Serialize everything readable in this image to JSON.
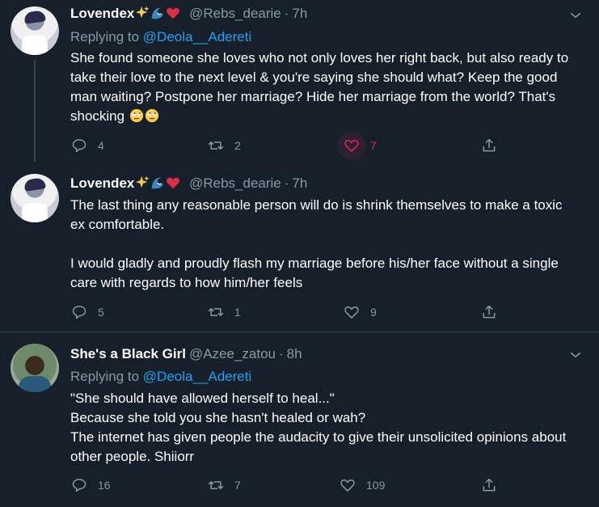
{
  "tweets": [
    {
      "name": "Lovendex",
      "name_emoji": [
        "sparkles-icon",
        "wave-icon",
        "heart-icon"
      ],
      "handle": "@Rebs_dearie",
      "dot": "·",
      "time": "7h",
      "replying_prefix": "Replying to",
      "replying_to": "@Deola__Adereti",
      "text": "She found someone she loves who not only loves her right back, but also ready to take their love to the next level & you're saying she should what? Keep the good man waiting? Postpone her marriage? Hide her marriage from the world? That's shocking",
      "text_emoji": [
        "face-with-rolling-eyes-icon",
        "face-with-rolling-eyes-icon"
      ],
      "replies": "4",
      "retweets": "2",
      "likes": "7",
      "liked": true
    },
    {
      "name": "Lovendex",
      "name_emoji": [
        "sparkles-icon",
        "wave-icon",
        "heart-icon"
      ],
      "handle": "@Rebs_dearie",
      "dot": "·",
      "time": "7h",
      "text_p1": "The last thing any reasonable person will do is shrink themselves to make a toxic ex comfortable.",
      "text_p2": "I would gladly and proudly flash my marriage before his/her face without a single care with regards to how him/her feels",
      "replies": "5",
      "retweets": "1",
      "likes": "9",
      "liked": false
    },
    {
      "name": "She's a Black Girl",
      "handle": "@Azee_zatou",
      "dot": "·",
      "time": "8h",
      "replying_prefix": "Replying to",
      "replying_to": "@Deola__Adereti",
      "text_lines": [
        "\"She should have allowed herself to heal...\"",
        "Because she told you she hasn't healed or wah?",
        "The internet has given people the audacity to give their unsolicited opinions about other people. Shiiorr"
      ],
      "replies": "16",
      "retweets": "7",
      "likes": "109",
      "liked": false
    }
  ],
  "colors": {
    "background": "#15202b",
    "secondary_text": "#8899a6",
    "link": "#1da1f2",
    "like_active": "#e0245e",
    "divider": "#38444d"
  }
}
